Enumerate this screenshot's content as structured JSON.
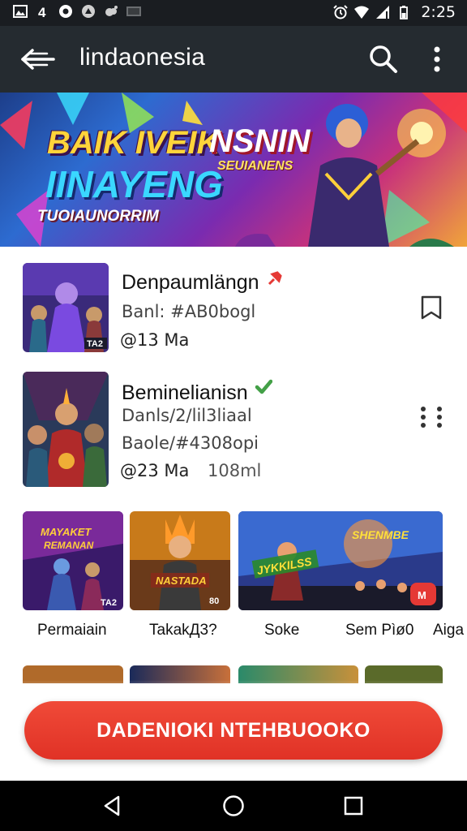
{
  "status_bar": {
    "time": "2:25",
    "left_icons": [
      "gallery-icon",
      "notification-4-icon",
      "circle-badge-icon",
      "app-icon",
      "cloud-icon",
      "image-icon"
    ],
    "right_icons": [
      "alarm-icon",
      "wifi-icon",
      "signal-icon",
      "battery-icon"
    ]
  },
  "app_bar": {
    "title": "lindaonesia",
    "icons": [
      "back-icon",
      "search-icon",
      "more-vert-icon"
    ]
  },
  "banner": {
    "line1_left": "BAIK IVEIK",
    "line1_right": "NSNIN",
    "line_sub": "SEUIANENS",
    "line2": "IINAYENG",
    "line3": "TUOIAUNORRIM"
  },
  "list": [
    {
      "title": "Denpaumlängn",
      "line1": "Banl: #AB0bogl",
      "line2": "@13 Ma",
      "badge_color": "#e53935",
      "action_icon": "bookmark-icon"
    },
    {
      "title": "Beminelianisn",
      "line1": "Danls/2/lil3liaal",
      "line2": "Baole/#4308opi",
      "line3_left": "@23 Ma",
      "line3_right": "108ml",
      "badge_color": "#43a047",
      "action_icon": "more-grid-icon"
    }
  ],
  "grid": [
    {
      "label": "Permaiain",
      "tile_text": "MAYAKET\nREMANAN",
      "corner": "TA2"
    },
    {
      "label": "TakakД3?",
      "tile_text": "NASTADA",
      "corner": "80"
    },
    {
      "label": "Soke",
      "tile_text": "JYKKILSS"
    },
    {
      "label": "Sem Pìø0",
      "tile_text": "SHENMBE"
    },
    {
      "label": "Aiga"
    }
  ],
  "cta": {
    "label": "DADENIOKI NTEHBUOOKO"
  },
  "nav": {
    "icons": [
      "back-triangle-icon",
      "home-circle-icon",
      "recents-square-icon"
    ]
  },
  "colors": {
    "status_bar": "#1a1d21",
    "app_bar": "#252b30",
    "cta": "#e53a2c",
    "nav_bar": "#000000"
  }
}
